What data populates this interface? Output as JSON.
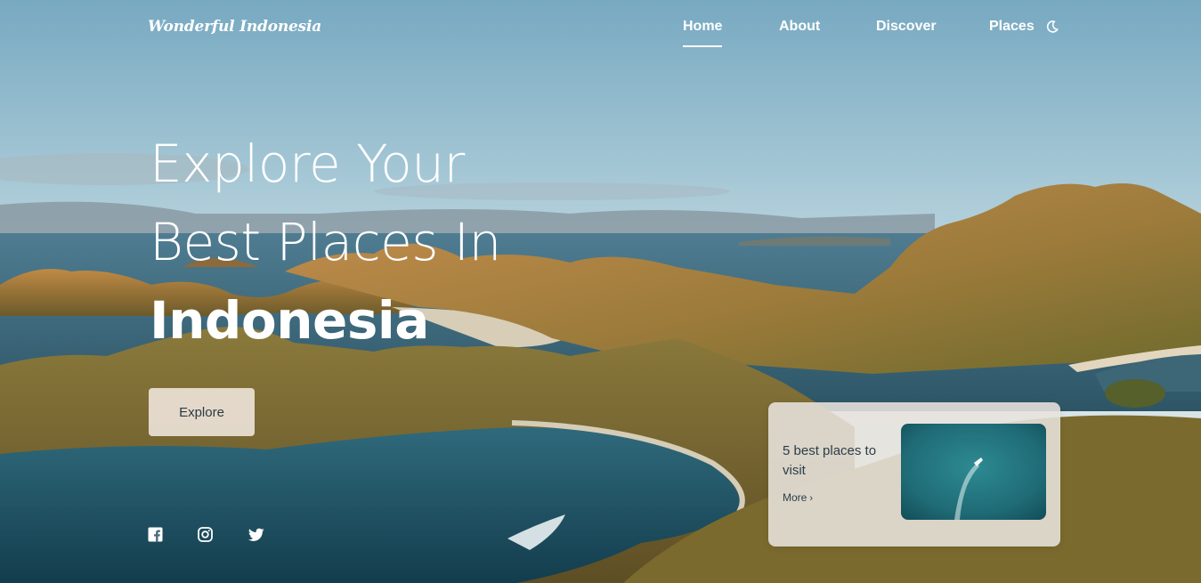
{
  "header": {
    "logo": "Wonderful Indonesia",
    "nav": [
      {
        "label": "Home",
        "active": true
      },
      {
        "label": "About",
        "active": false
      },
      {
        "label": "Discover",
        "active": false
      },
      {
        "label": "Places",
        "active": false
      }
    ],
    "theme_toggle_icon": "moon-icon"
  },
  "hero": {
    "headline": [
      "Explore Your",
      "Best Places In",
      "Indonesia"
    ],
    "cta_label": "Explore",
    "background": "landscape-photo"
  },
  "socials": [
    {
      "icon": "facebook-icon"
    },
    {
      "icon": "instagram-icon"
    },
    {
      "icon": "twitter-icon"
    }
  ],
  "card": {
    "title": "5 best places to visit",
    "more_label": "More",
    "more_icon": "chevron-right-icon",
    "image": "ocean-boat-photo"
  },
  "colors": {
    "text": "#ffffff",
    "button_bg": "#ece2d6",
    "card_bg": "#e8e4de",
    "card_text": "#2c3e48"
  }
}
